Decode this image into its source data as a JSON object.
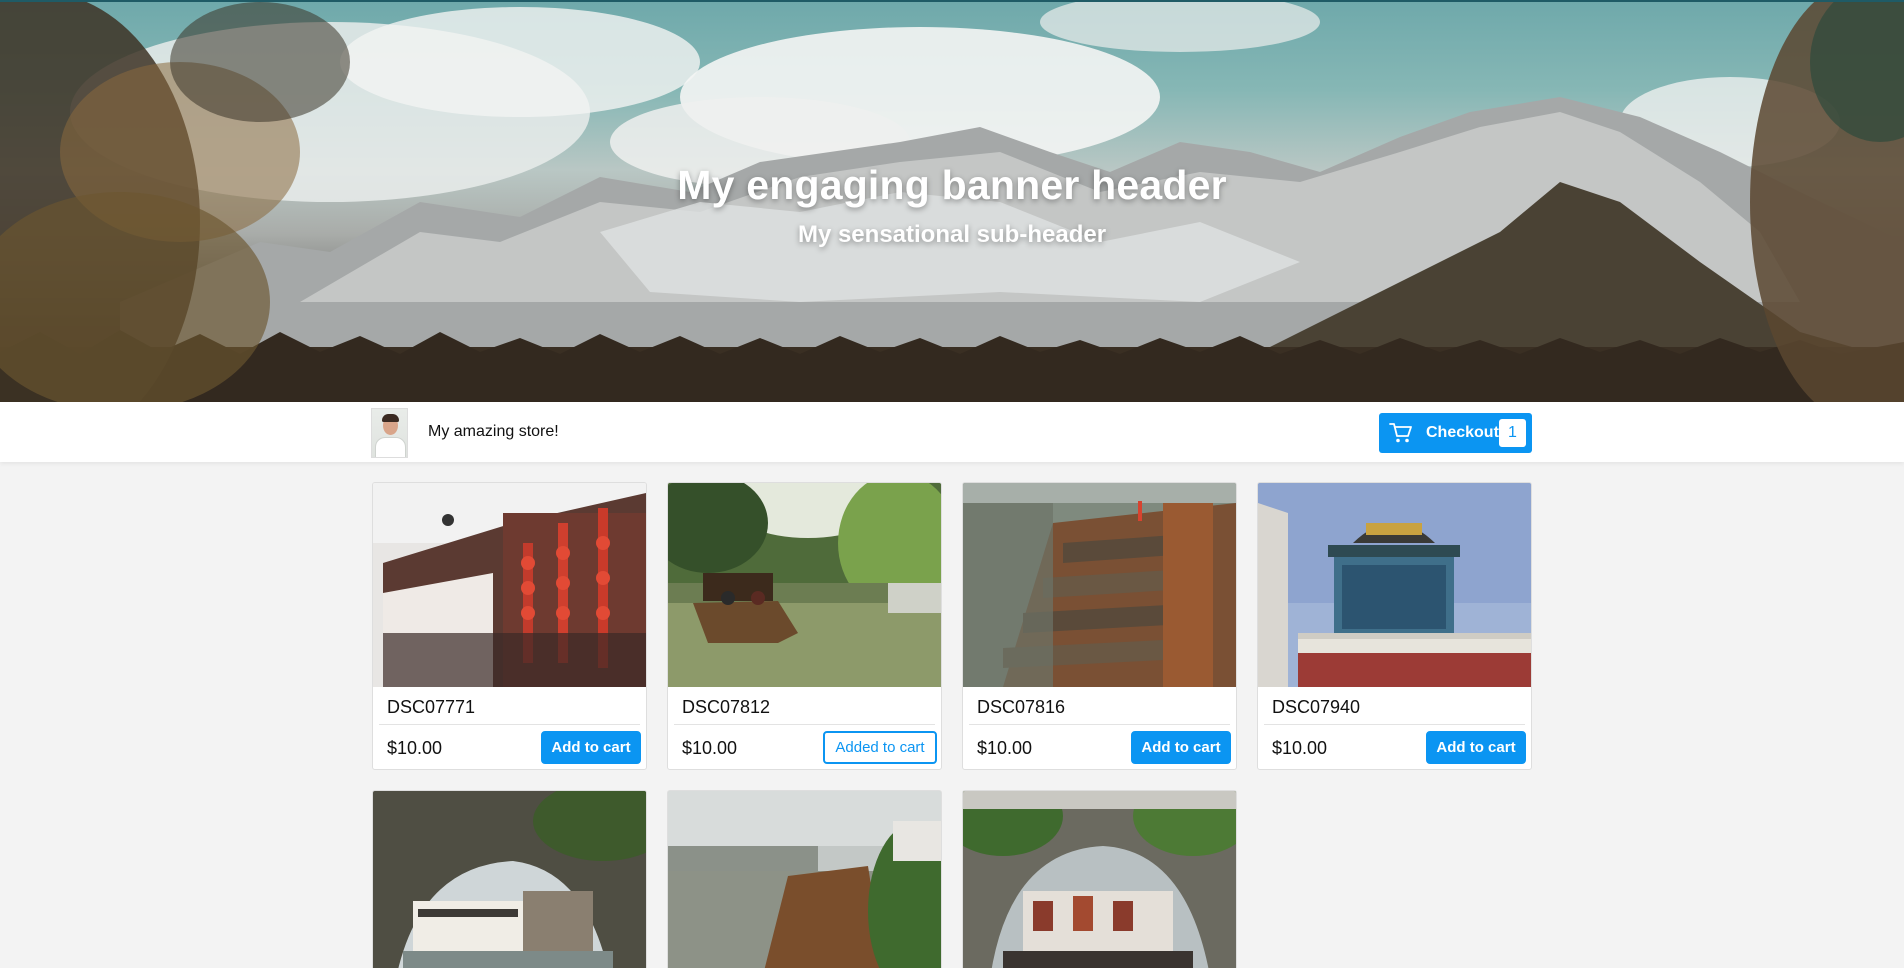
{
  "banner": {
    "title": "My engaging banner header",
    "subtitle": "My sensational sub-header"
  },
  "store": {
    "name": "My amazing store!",
    "checkout_label": "Checkout",
    "cart_count": "1"
  },
  "colors": {
    "accent": "#0b95f2",
    "page_background": "#f3f3f3"
  },
  "products": [
    {
      "title": "DSC07771",
      "price": "$10.00",
      "button": "Add to cart",
      "in_cart": false
    },
    {
      "title": "DSC07812",
      "price": "$10.00",
      "button": "Added to cart",
      "in_cart": true
    },
    {
      "title": "DSC07816",
      "price": "$10.00",
      "button": "Add to cart",
      "in_cart": false
    },
    {
      "title": "DSC07940",
      "price": "$10.00",
      "button": "Add to cart",
      "in_cart": false
    },
    {
      "title": "",
      "price": "",
      "button": "",
      "in_cart": false
    },
    {
      "title": "",
      "price": "",
      "button": "",
      "in_cart": false
    },
    {
      "title": "",
      "price": "",
      "button": "",
      "in_cart": false
    }
  ]
}
